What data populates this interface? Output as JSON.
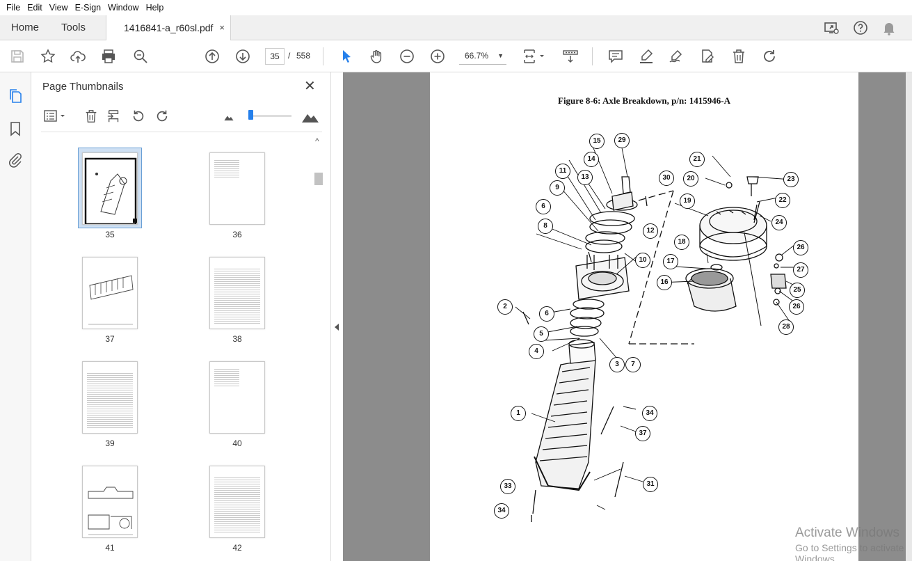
{
  "menu": [
    "File",
    "Edit",
    "View",
    "E-Sign",
    "Window",
    "Help"
  ],
  "nav": {
    "home": "Home",
    "tools": "Tools"
  },
  "doc_tab": {
    "title": "1416841-a_r60sl.pdf",
    "close": "×"
  },
  "toolbar": {
    "current_page": "35",
    "page_separator": "/",
    "total_pages": "558",
    "zoom": "66.7%"
  },
  "thumbnails_panel": {
    "title": "Page Thumbnails",
    "close": "✕",
    "pages": [
      {
        "num": "35",
        "kind": "figure",
        "selected": true
      },
      {
        "num": "36",
        "kind": "table"
      },
      {
        "num": "37",
        "kind": "figure2"
      },
      {
        "num": "38",
        "kind": "notes"
      },
      {
        "num": "39",
        "kind": "notes"
      },
      {
        "num": "40",
        "kind": "table"
      },
      {
        "num": "41",
        "kind": "figure3"
      },
      {
        "num": "42",
        "kind": "notes"
      }
    ]
  },
  "document": {
    "figure_title": "Figure 8-6:  Axle Breakdown, p/n: 1415946-A",
    "callouts": [
      "1",
      "2",
      "3",
      "4",
      "5",
      "6",
      "6",
      "7",
      "8",
      "9",
      "10",
      "11",
      "12",
      "13",
      "14",
      "15",
      "16",
      "17",
      "18",
      "19",
      "20",
      "21",
      "22",
      "23",
      "24",
      "25",
      "26",
      "26",
      "27",
      "28",
      "29",
      "30",
      "31",
      "33",
      "34",
      "34",
      "37"
    ]
  },
  "watermark": {
    "line1": "Activate Windows",
    "line2": "Go to Settings to activate Windows."
  },
  "colors": {
    "accent": "#2680eb",
    "doc_background": "#8c8c8c",
    "selection": "#cfe0f3"
  }
}
